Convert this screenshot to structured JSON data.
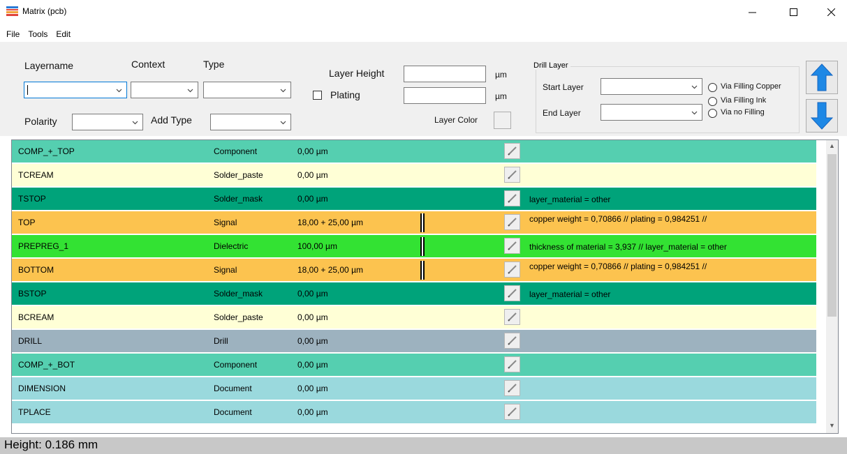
{
  "window": {
    "title": "Matrix (pcb)"
  },
  "menu": [
    "File",
    "Tools",
    "Edit"
  ],
  "toolbar": {
    "layername_label": "Layername",
    "context_label": "Context",
    "type_label": "Type",
    "polarity_label": "Polarity",
    "add_type_label": "Add Type",
    "layer_height_label": "Layer Height",
    "plating_label": "Plating",
    "unit_um": "µm",
    "layer_color_label": "Layer Color"
  },
  "drill_layer": {
    "title": "Drill Layer",
    "start_label": "Start Layer",
    "end_label": "End Layer",
    "options": [
      "Via Filling Copper",
      "Via Filling Ink",
      "Via no Filling"
    ]
  },
  "rows": [
    {
      "name": "COMP_+_TOP",
      "context": "Component",
      "thickness": "0,00 µm",
      "note": "",
      "color": "#55cfb0",
      "bar": false
    },
    {
      "name": "TCREAM",
      "context": "Solder_paste",
      "thickness": "0,00 µm",
      "note": "",
      "color": "#ffffd6",
      "bar": false
    },
    {
      "name": "TSTOP",
      "context": "Solder_mask",
      "thickness": "0,00 µm",
      "note": "layer_material = other",
      "color": "#00a37a",
      "bar": false
    },
    {
      "name": "TOP",
      "context": "Signal",
      "thickness": "18,00 + 25,00 µm",
      "note": "copper weight = 0,70866 // plating = 0,984251 //",
      "color": "#fcc34f",
      "bar": true
    },
    {
      "name": "PREPREG_1",
      "context": "Dielectric",
      "thickness": "100,00 µm",
      "note": "thickness of material = 3,937 // layer_material = other",
      "color": "#33e233",
      "bar": true
    },
    {
      "name": "BOTTOM",
      "context": "Signal",
      "thickness": "18,00 + 25,00 µm",
      "note": "copper weight = 0,70866 // plating = 0,984251 //",
      "color": "#fcc34f",
      "bar": true
    },
    {
      "name": "BSTOP",
      "context": "Solder_mask",
      "thickness": "0,00 µm",
      "note": "layer_material = other",
      "color": "#00a37a",
      "bar": false
    },
    {
      "name": "BCREAM",
      "context": "Solder_paste",
      "thickness": "0,00 µm",
      "note": "",
      "color": "#ffffd6",
      "bar": false
    },
    {
      "name": "DRILL",
      "context": "Drill",
      "thickness": "0,00 µm",
      "note": "",
      "color": "#9db2bf",
      "bar": false
    },
    {
      "name": "COMP_+_BOT",
      "context": "Component",
      "thickness": "0,00 µm",
      "note": "",
      "color": "#55cfb0",
      "bar": false
    },
    {
      "name": "DIMENSION",
      "context": "Document",
      "thickness": "0,00 µm",
      "note": "",
      "color": "#9ad9dd",
      "bar": false
    },
    {
      "name": "TPLACE",
      "context": "Document",
      "thickness": "0,00 µm",
      "note": "",
      "color": "#9ad9dd",
      "bar": false
    }
  ],
  "status": {
    "text": "Height: 0.186 mm"
  },
  "colors": {
    "up_arrow": "#1e88e5",
    "down_arrow": "#1e88e5"
  }
}
